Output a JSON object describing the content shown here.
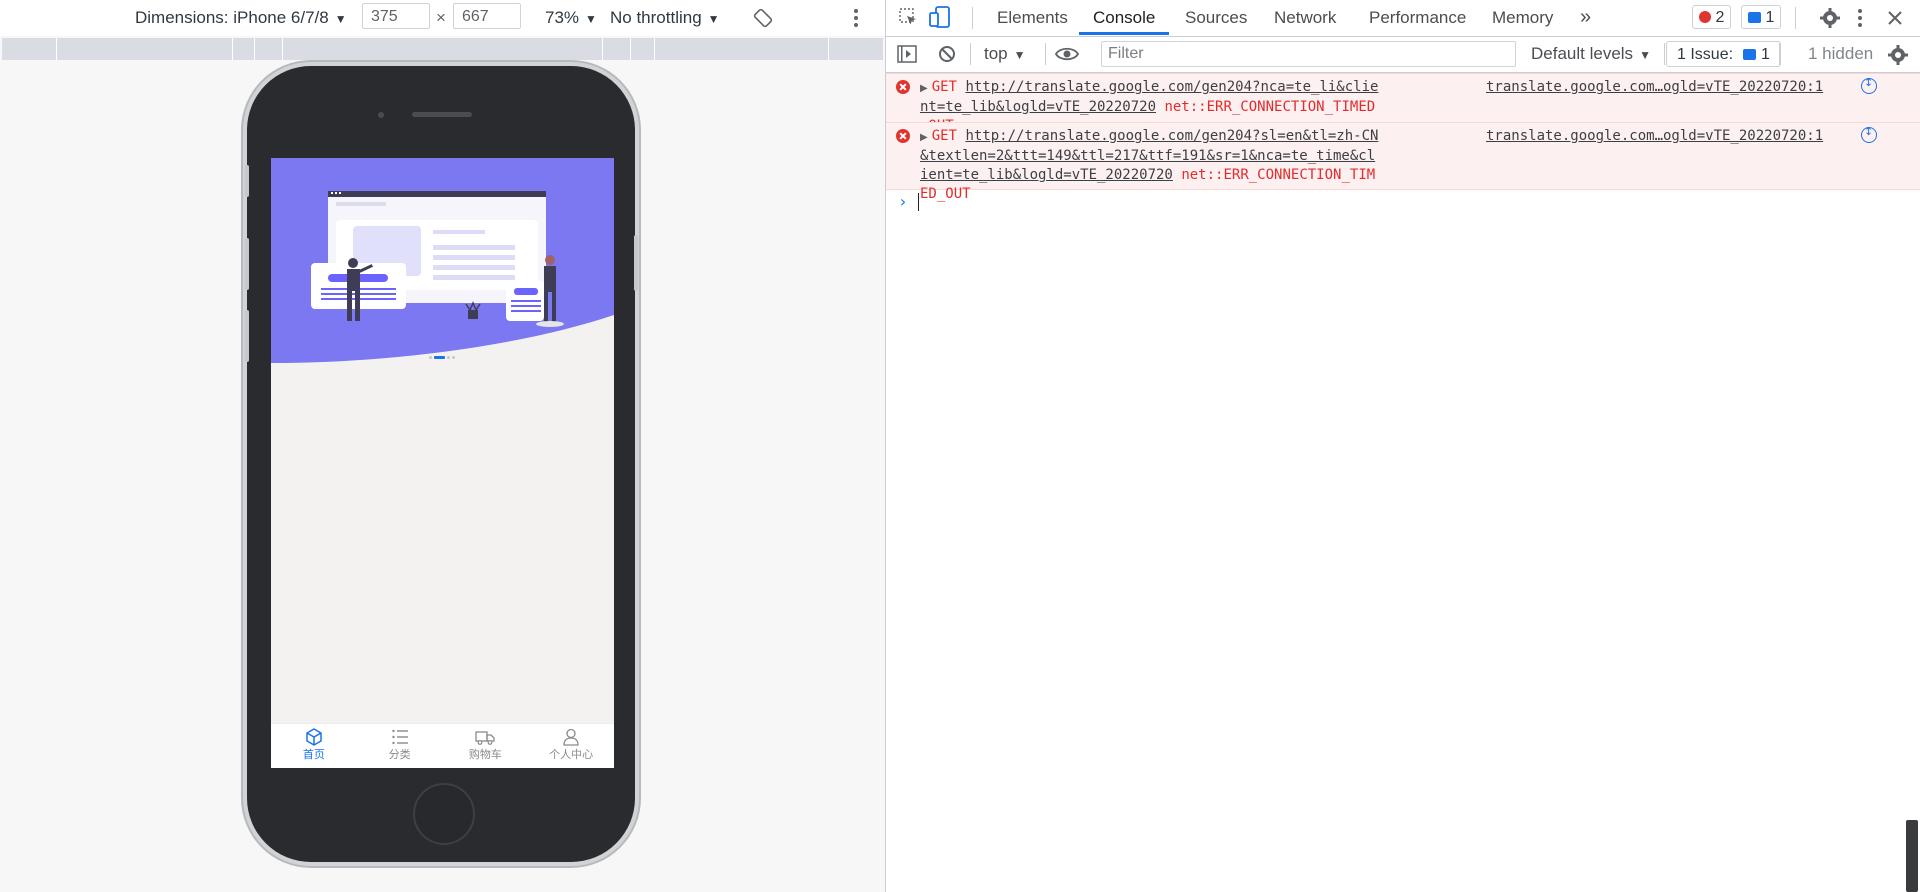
{
  "device_toolbar": {
    "dimensions_label": "Dimensions: iPhone 6/7/8",
    "width_value": "375",
    "times": "×",
    "height_value": "667",
    "zoom": "73%",
    "throttling": "No throttling"
  },
  "mobile_app": {
    "carousel": {
      "slide_count": 4,
      "active_index": 1
    },
    "tabs": [
      {
        "label": "首页",
        "icon": "home-cube-icon",
        "active": true
      },
      {
        "label": "分类",
        "icon": "list-icon",
        "active": false
      },
      {
        "label": "购物车",
        "icon": "truck-icon",
        "active": false
      },
      {
        "label": "个人中心",
        "icon": "user-icon",
        "active": false
      }
    ],
    "hero_color": "#7b78f2",
    "active_tab_color": "#1a73e8"
  },
  "devtools": {
    "tabs": [
      "Elements",
      "Console",
      "Sources",
      "Network",
      "Performance",
      "Memory"
    ],
    "active_tab": "Console",
    "more_tabs": "»",
    "error_count": "2",
    "message_count": "1",
    "console_toolbar": {
      "context": "top",
      "filter_placeholder": "Filter",
      "levels": "Default levels",
      "issues_label": "1 Issue:",
      "issues_count": "1",
      "hidden": "1 hidden"
    },
    "logs": [
      {
        "method": "GET",
        "url": "http://translate.google.com/gen204?nca=te_li&client=te_lib&logld=vTE_20220720",
        "error": "net::ERR_CONNECTION_TIMED_OUT",
        "source": "translate.google.com…ogld=vTE_20220720:1"
      },
      {
        "method": "GET",
        "url": "http://translate.google.com/gen204?sl=en&tl=zh-CN&textlen=2&ttt=149&ttl=217&ttf=191&sr=1&nca=te_time&client=te_lib&logld=vTE_20220720",
        "error": "net::ERR_CONNECTION_TIMED_OUT",
        "source": "translate.google.com…ogld=vTE_20220720:1"
      }
    ],
    "prompt_symbol": "›"
  }
}
